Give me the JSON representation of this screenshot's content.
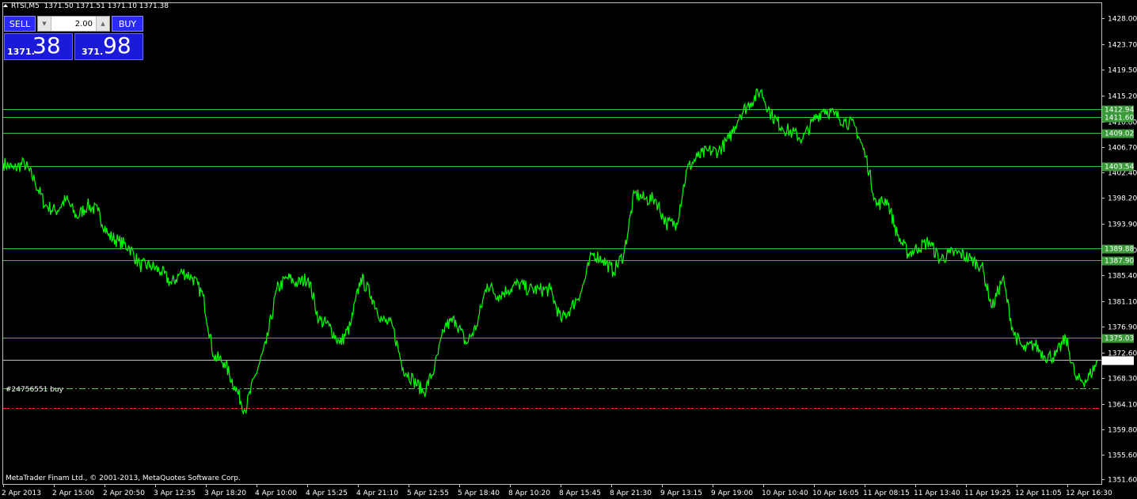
{
  "header": {
    "symbol": "RTSI,M5",
    "ohlc": "1371.50 1371.51 1371.10 1371.38"
  },
  "one_click": {
    "sell_label": "SELL",
    "buy_label": "BUY",
    "lot_value": "2.00",
    "sell_small": "1371.",
    "sell_big": "38",
    "buy_small": "371.",
    "buy_big": "98"
  },
  "order_label": "#24756551 buy",
  "copyright": "MetaTrader Finam Ltd., © 2001-2013, MetaQuotes Software Corp.",
  "colors": {
    "background": "#000000",
    "price_line": "#00ff00",
    "level_line": "#3bbf3b",
    "level_label_bg": "#3a9a3a",
    "order_line": "#3bbf3b",
    "stop_line": "#ff2020",
    "current_line": "#c0c0c0"
  },
  "chart_data": {
    "type": "line",
    "title": "",
    "xlabel": "",
    "ylabel": "",
    "ylim": [
      1350.8,
      1430.5
    ],
    "y_ticks": [
      "1428.00",
      "1423.70",
      "1419.50",
      "1415.20",
      "1410.80",
      "1406.70",
      "1402.40",
      "1398.20",
      "1393.90",
      "1389.60",
      "1385.40",
      "1381.10",
      "1376.90",
      "1372.60",
      "1368.30",
      "1364.10",
      "1359.80",
      "1355.60",
      "1351.60"
    ],
    "x_ticks": [
      "2 Apr 2013",
      "2 Apr 15:00",
      "2 Apr 20:50",
      "3 Apr 12:35",
      "3 Apr 18:20",
      "4 Apr 10:00",
      "4 Apr 15:25",
      "4 Apr 21:10",
      "5 Apr 12:55",
      "5 Apr 18:40",
      "8 Apr 10:20",
      "8 Apr 15:45",
      "8 Apr 21:30",
      "9 Apr 13:15",
      "9 Apr 19:00",
      "10 Apr 10:40",
      "10 Apr 16:05",
      "11 Apr 08:15",
      "11 Apr 13:40",
      "11 Apr 19:25",
      "12 Apr 11:05",
      "12 Apr 16:30"
    ],
    "levels": [
      {
        "value": 1412.94,
        "label": "1412.94"
      },
      {
        "value": 1411.6,
        "label": "1411.60"
      },
      {
        "value": 1409.02,
        "label": "1409.02"
      },
      {
        "value": 1403.54,
        "label": "1403.54"
      },
      {
        "value": 1389.88,
        "label": "1389.88"
      },
      {
        "value": 1387.9,
        "label": "1387.90"
      },
      {
        "value": 1375.03,
        "label": "1375.03"
      }
    ],
    "current_price": {
      "value": 1371.38,
      "label": "1371.38"
    },
    "order_line": 1366.7,
    "stop_line": 1363.4,
    "series": [
      {
        "values": [
          [
            0,
            1404
          ],
          [
            1,
            1403
          ],
          [
            2,
            1404
          ],
          [
            3,
            1401
          ],
          [
            4,
            1397
          ],
          [
            5,
            1396
          ],
          [
            6,
            1398
          ],
          [
            7,
            1395
          ],
          [
            8,
            1397
          ],
          [
            9,
            1396
          ],
          [
            10,
            1392
          ],
          [
            11,
            1391
          ],
          [
            12,
            1390
          ],
          [
            13,
            1387
          ],
          [
            14,
            1387
          ],
          [
            15,
            1386
          ],
          [
            16,
            1384
          ],
          [
            17,
            1386
          ],
          [
            18,
            1385
          ],
          [
            19,
            1382
          ],
          [
            20,
            1372
          ],
          [
            21,
            1371
          ],
          [
            22,
            1367
          ],
          [
            23,
            1363
          ],
          [
            24,
            1369
          ],
          [
            25,
            1374
          ],
          [
            26,
            1383
          ],
          [
            27,
            1385
          ],
          [
            28,
            1384
          ],
          [
            29,
            1385
          ],
          [
            30,
            1378
          ],
          [
            31,
            1377
          ],
          [
            32,
            1374
          ],
          [
            33,
            1377
          ],
          [
            34,
            1385
          ],
          [
            35,
            1382
          ],
          [
            36,
            1378
          ],
          [
            37,
            1377
          ],
          [
            38,
            1370
          ],
          [
            39,
            1368
          ],
          [
            40,
            1366
          ],
          [
            41,
            1370
          ],
          [
            42,
            1377
          ],
          [
            43,
            1378
          ],
          [
            44,
            1374
          ],
          [
            45,
            1377
          ],
          [
            46,
            1384
          ],
          [
            47,
            1382
          ],
          [
            48,
            1383
          ],
          [
            49,
            1384
          ],
          [
            50,
            1383
          ],
          [
            51,
            1383
          ],
          [
            52,
            1383
          ],
          [
            53,
            1378
          ],
          [
            54,
            1380
          ],
          [
            55,
            1383
          ],
          [
            56,
            1389
          ],
          [
            57,
            1388
          ],
          [
            58,
            1386
          ],
          [
            59,
            1389
          ],
          [
            60,
            1399
          ],
          [
            61,
            1398
          ],
          [
            62,
            1398
          ],
          [
            63,
            1394
          ],
          [
            64,
            1394
          ],
          [
            65,
            1403
          ],
          [
            66,
            1405
          ],
          [
            67,
            1406
          ],
          [
            68,
            1406
          ],
          [
            69,
            1408
          ],
          [
            70,
            1412
          ],
          [
            71,
            1414
          ],
          [
            72,
            1416
          ],
          [
            73,
            1412
          ],
          [
            74,
            1410
          ],
          [
            75,
            1409
          ],
          [
            76,
            1408
          ],
          [
            77,
            1411
          ],
          [
            78,
            1413
          ],
          [
            79,
            1412
          ],
          [
            80,
            1411
          ],
          [
            81,
            1410
          ],
          [
            82,
            1405
          ],
          [
            83,
            1397
          ],
          [
            84,
            1398
          ],
          [
            85,
            1392
          ],
          [
            86,
            1389
          ],
          [
            87,
            1390
          ],
          [
            88,
            1391
          ],
          [
            89,
            1388
          ],
          [
            90,
            1389
          ],
          [
            91,
            1389
          ],
          [
            92,
            1388
          ],
          [
            93,
            1387
          ],
          [
            94,
            1380
          ],
          [
            95,
            1385
          ],
          [
            96,
            1376
          ],
          [
            97,
            1373
          ],
          [
            98,
            1374
          ],
          [
            99,
            1372
          ],
          [
            100,
            1372
          ],
          [
            101,
            1375
          ],
          [
            102,
            1368
          ],
          [
            103,
            1368
          ],
          [
            104,
            1371
          ]
        ]
      }
    ]
  }
}
